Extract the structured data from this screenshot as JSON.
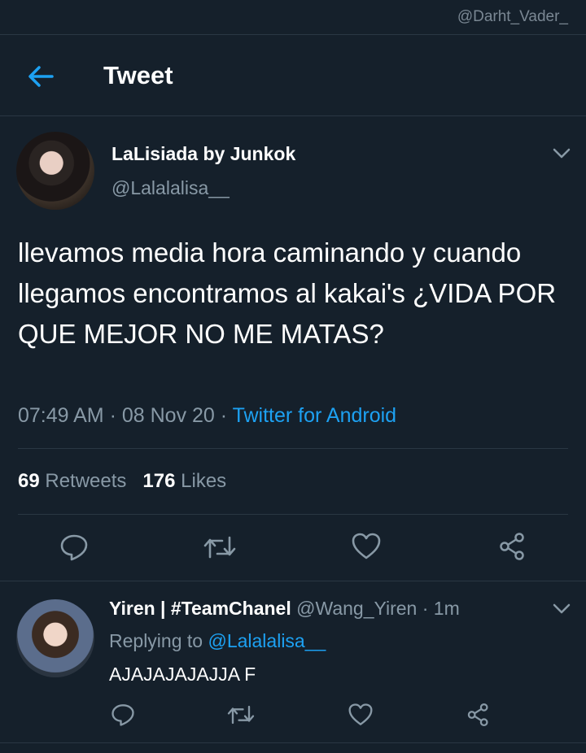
{
  "watermark": "@Darht_Vader_",
  "header": {
    "title": "Tweet"
  },
  "tweet": {
    "display_name": "LaLisiada by Junkok",
    "handle": "@Lalalalisa__",
    "text": "llevamos media hora caminando y cuando llegamos encontramos al kakai's ¿VIDA POR QUE MEJOR NO ME MATAS?",
    "time": "07:49 AM",
    "date": "08 Nov 20",
    "source": "Twitter for Android",
    "retweets_count": "69",
    "retweets_label": "Retweets",
    "likes_count": "176",
    "likes_label": "Likes"
  },
  "reply": {
    "display_name": "Yiren | #TeamChanel",
    "handle": "@Wang_Yiren",
    "time": "1m",
    "replying_prefix": "Replying to",
    "replying_to": "@Lalalalisa__",
    "text": "AJAJAJAJAJJA F"
  },
  "icons": {
    "back": "arrow-left-icon",
    "more": "chevron-down-icon",
    "reply": "reply-icon",
    "retweet": "retweet-icon",
    "like": "heart-icon",
    "share": "share-icon"
  },
  "colors": {
    "background": "#15202b",
    "accent": "#1da1f2",
    "secondary_text": "#8899a6",
    "divider": "#2a3743"
  }
}
